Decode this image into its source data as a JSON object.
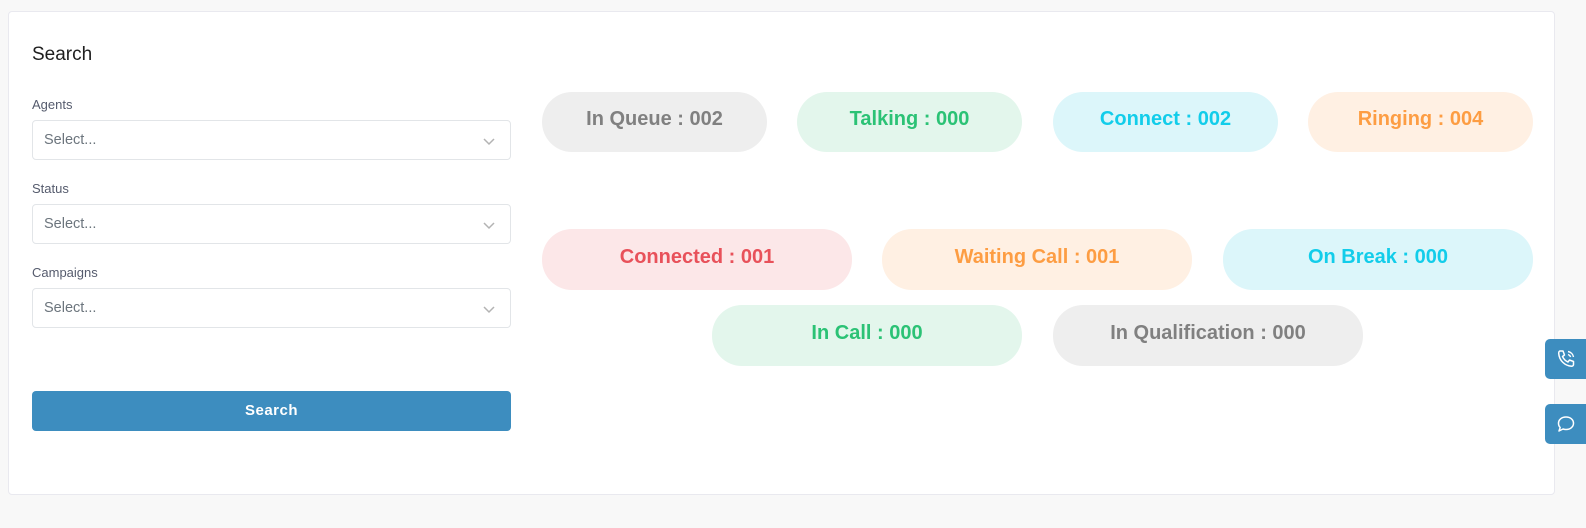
{
  "search_panel": {
    "title": "Search",
    "agents": {
      "label": "Agents",
      "placeholder": "Select..."
    },
    "status": {
      "label": "Status",
      "placeholder": "Select..."
    },
    "campaigns": {
      "label": "Campaigns",
      "placeholder": "Select..."
    },
    "search_button": "Search"
  },
  "stats": {
    "in_queue": "In Queue : 002",
    "talking": "Talking : 000",
    "connect": "Connect : 002",
    "ringing": "Ringing : 004",
    "connected": "Connected : 001",
    "waiting_call": "Waiting Call : 001",
    "on_break": "On Break : 000",
    "in_call": "In Call : 000",
    "in_qualification": "In Qualification : 000"
  },
  "colors": {
    "primary": "#3d8dbf",
    "gray_text": "#808080",
    "green_text": "#2bc275",
    "cyan_text": "#12cdea",
    "orange_text": "#fd9d43",
    "red_text": "#e8515a"
  },
  "side_tabs": {
    "call_icon": "phone-icon",
    "chat_icon": "chat-icon"
  }
}
